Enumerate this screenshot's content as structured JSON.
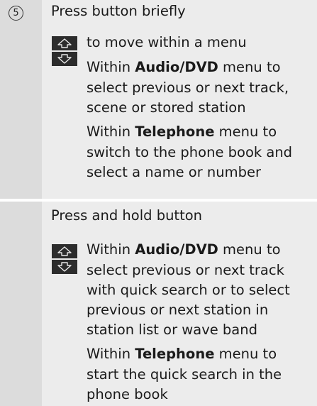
{
  "item_number": "5",
  "section1": {
    "heading": "Press button briefly",
    "line_move": "to move within a menu",
    "audio_label": "Within ",
    "audio_bold": "Audio/DVD",
    "audio_suffix": " menu to",
    "audio_line2": "select previous or next track,",
    "audio_line3": "scene or stored station",
    "tel_label": "Within ",
    "tel_bold": "Telephone",
    "tel_suffix": " menu to",
    "tel_line2": "switch to the phone book and",
    "tel_line3": "select a name or number"
  },
  "section2": {
    "heading": "Press and hold button",
    "audio_label": "Within ",
    "audio_bold": "Audio/DVD",
    "audio_suffix": " menu to",
    "audio_line2": "select previous or next track",
    "audio_line3": "with quick search or to select",
    "audio_line4": "previous or next station in",
    "audio_line5": "station list or wave band",
    "tel_label": "Within ",
    "tel_bold": "Telephone",
    "tel_suffix": " menu to",
    "tel_line2": "start the quick search in the",
    "tel_line3": "phone book"
  }
}
